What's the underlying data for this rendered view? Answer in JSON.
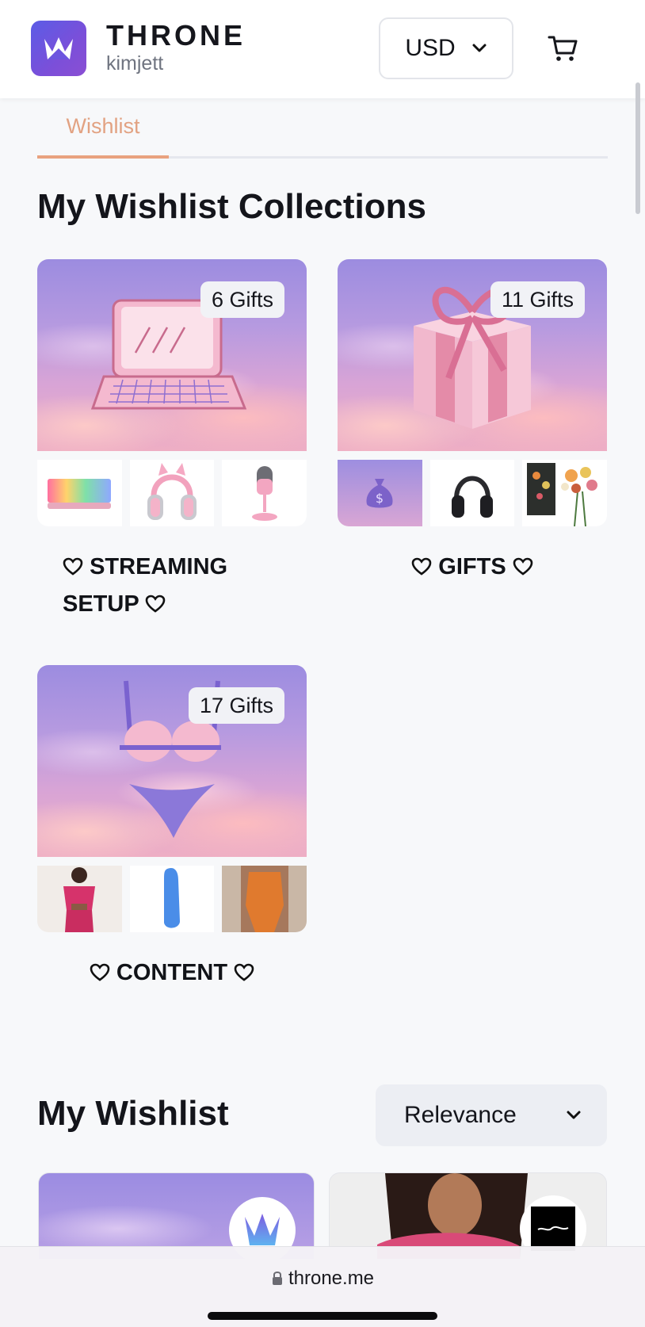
{
  "header": {
    "brand": "THRONE",
    "username": "kimjett",
    "currency": "USD"
  },
  "tabs": {
    "active": "Wishlist"
  },
  "collections": {
    "title": "My Wishlist Collections",
    "items": [
      {
        "gifts": "6 Gifts",
        "name_line1": "STREAMING",
        "name_line2": "SETUP",
        "hero_icon": "laptop-icon",
        "thumbnails": [
          "rgb-keyboard",
          "pink-cat-headset",
          "pink-microphone"
        ]
      },
      {
        "gifts": "11 Gifts",
        "name": "GIFTS",
        "hero_icon": "gift-box-icon",
        "thumbnails": [
          "money-bag-icon",
          "black-headphones",
          "flower-bouquet-set"
        ]
      },
      {
        "gifts": "17 Gifts",
        "name": "CONTENT",
        "hero_icon": "lingerie-icon",
        "thumbnails": [
          "pink-outfit-photo",
          "blue-toy-photo",
          "orange-lingerie-photo"
        ]
      }
    ]
  },
  "wishlist": {
    "title": "My Wishlist",
    "sort": "Relevance",
    "card_badges": [
      "throne-logo",
      "dolls-kill-logo"
    ]
  },
  "browser": {
    "url": "throne.me"
  },
  "colors": {
    "accent": "#E9A27F",
    "brand": "#6A55E0"
  }
}
